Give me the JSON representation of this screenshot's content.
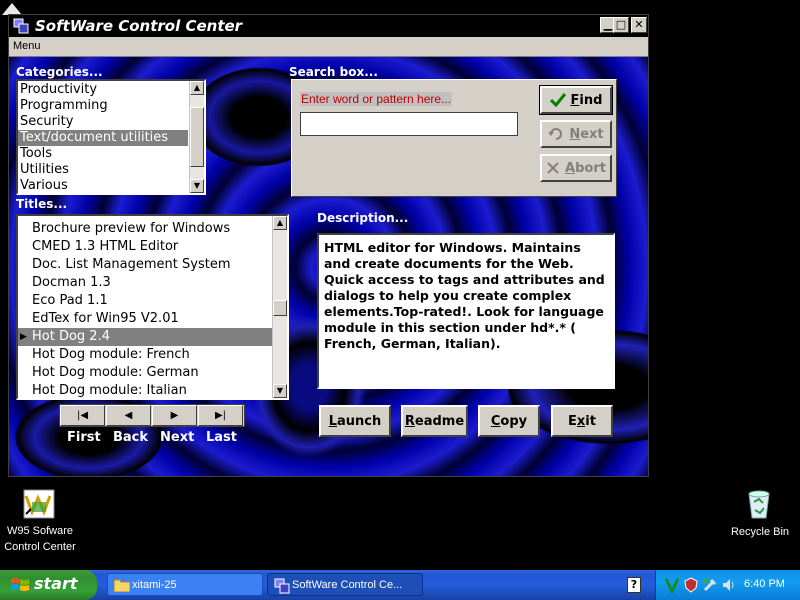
{
  "window": {
    "title": "SoftWare Control Center",
    "menu": "Menu",
    "controls": {
      "minimize": "▁",
      "maximize": "□",
      "close": "✕"
    }
  },
  "categories": {
    "label": "Categories...",
    "items": [
      "Productivity",
      "Programming",
      "Security",
      "Text/document utilities",
      "Tools",
      "Utilities",
      "Various"
    ],
    "selected": "Text/document utilities"
  },
  "titles": {
    "label": "Titles...",
    "items": [
      "Brochure preview for Windows",
      "CMED 1.3 HTML Editor",
      "Doc. List Management System",
      "Docman 1.3",
      "Eco Pad 1.1",
      "EdTex for Win95  V2.01",
      "Hot Dog 2.4",
      "Hot Dog module: French",
      "Hot Dog module: German",
      "Hot Dog module: Italian"
    ],
    "selected": "Hot Dog 2.4"
  },
  "search": {
    "label": "Search box...",
    "placeholder": "Enter word or pattern here...",
    "value": "",
    "find": "Find",
    "next": "Next",
    "abort": "Abort"
  },
  "description": {
    "label": "Description...",
    "text": "HTML editor for Windows. Maintains and create documents for the Web. Quick access to tags and attributes and dialogs to help you create complex elements.Top-rated!. Look for language module in this section under hd*.* ( French, German, Italian)."
  },
  "nav": {
    "first_glyph": "|◀",
    "back_glyph": "◀",
    "next_glyph": "▶",
    "last_glyph": "▶|",
    "first": "First",
    "back": "Back",
    "next": "Next",
    "last": "Last"
  },
  "actions": {
    "launch": "Launch",
    "readme": "Readme",
    "copy": "Copy",
    "exit": "Exit"
  },
  "desktop": {
    "w95_line1": "W95 Sofware",
    "w95_line2": "Control Center",
    "recycle": "Recycle Bin"
  },
  "taskbar": {
    "start": "start",
    "task1": "xitami-25",
    "task2": "SoftWare Control Ce...",
    "help": "?",
    "clock": "6:40 PM"
  },
  "colors": {
    "selection": "#808080",
    "hint_text": "#c00000",
    "taskbar": "#245edb",
    "start": "#37a037"
  }
}
